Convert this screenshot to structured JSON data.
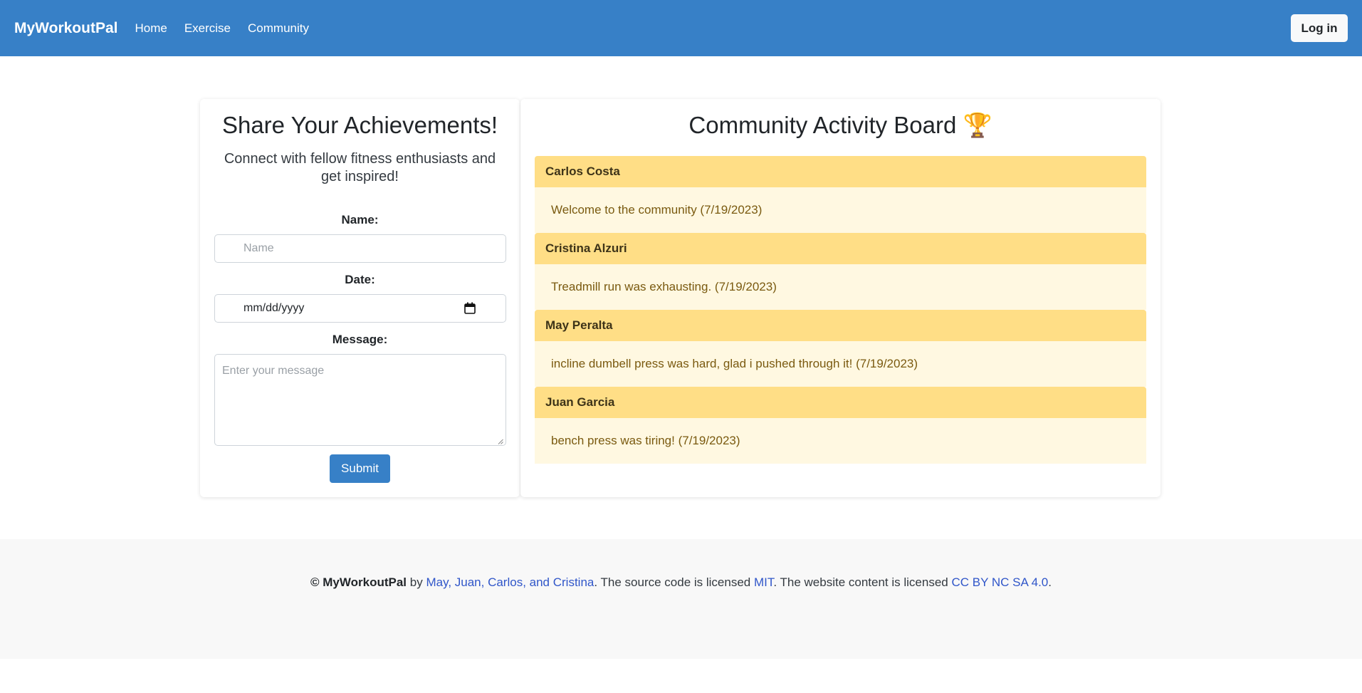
{
  "navbar": {
    "brand": "MyWorkoutPal",
    "links": [
      "Home",
      "Exercise",
      "Community"
    ],
    "login_label": "Log in",
    "color": "#3780c7"
  },
  "share": {
    "title": "Share Your Achievements!",
    "subtitle": "Connect with fellow fitness enthusiasts and get inspired!",
    "name_label": "Name:",
    "name_placeholder": "Name",
    "date_label": "Date:",
    "date_placeholder": "mm/dd/yyyy",
    "message_label": "Message:",
    "message_placeholder": "Enter your message",
    "submit_label": "Submit"
  },
  "board": {
    "title": "Community Activity Board 🏆",
    "posts": [
      {
        "author": "Carlos Costa",
        "message": "Welcome to the community (7/19/2023)"
      },
      {
        "author": "Cristina Alzuri",
        "message": "Treadmill run was exhausting. (7/19/2023)"
      },
      {
        "author": "May Peralta",
        "message": "incline dumbell press was hard, glad i pushed through it! (7/19/2023)"
      },
      {
        "author": "Juan Garcia",
        "message": "bench press was tiring! (7/19/2023)"
      }
    ]
  },
  "footer": {
    "copyright_symbol": "©",
    "brand": "MyWorkoutPal",
    "by": "by",
    "authors_link": "May, Juan, Carlos, and Cristina",
    "source_text": ". The source code is licensed",
    "mit_link": "MIT",
    "content_text": ". The website content is licensed",
    "cc_link": "CC BY NC SA 4.0",
    "end": "."
  }
}
